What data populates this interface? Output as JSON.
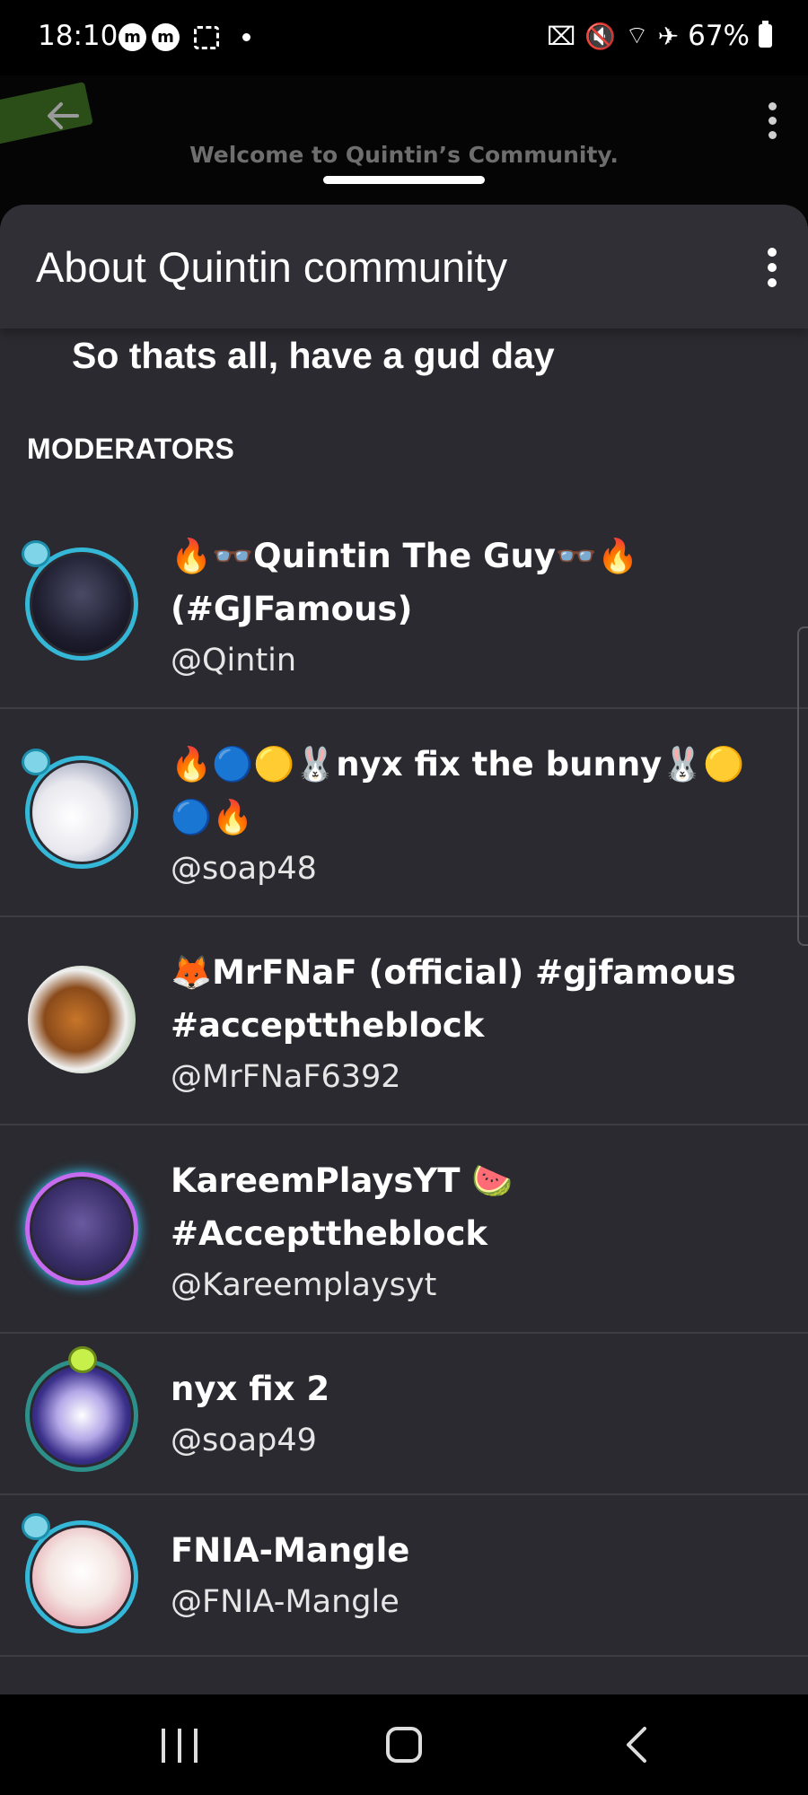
{
  "status_bar": {
    "time": "18:10",
    "left_badges": [
      "m",
      "m"
    ],
    "battery": "67%",
    "icons": [
      "battery-saver-icon",
      "mute-icon",
      "wifi-icon",
      "airplane-icon",
      "battery-icon"
    ]
  },
  "background": {
    "welcome": "Welcome to Quintin’s Community."
  },
  "sheet": {
    "title": "About Quintin community",
    "description": "So thats all, have a gud day",
    "section_label": "MODERATORS"
  },
  "moderators": [
    {
      "name": "🔥👓Quintin The Guy👓🔥 (#GJFamous)",
      "handle": "@Qintin",
      "ring_color": "#35b7d8",
      "badge": true
    },
    {
      "name": "🔥🔵🟡🐰nyx fix the bunny🐰🟡🔵🔥",
      "handle": "@soap48",
      "ring_color": "#35b7d8",
      "badge": true
    },
    {
      "name": "🦊MrFNaF (official) #gjfamous #accepttheblock",
      "handle": "@MrFNaF6392",
      "ring_color": "",
      "badge": false
    },
    {
      "name": "KareemPlaysYT 🍉 #Accepttheblock",
      "handle": "@Kareemplaysyt",
      "ring_color": "#c66cf0",
      "badge": false
    },
    {
      "name": "nyx fix 2",
      "handle": "@soap49",
      "ring_color": "#2d8f8a",
      "badge": true
    },
    {
      "name": "FNIA-Mangle",
      "handle": "@FNIA-Mangle",
      "ring_color": "#35b7d8",
      "badge": true
    }
  ]
}
